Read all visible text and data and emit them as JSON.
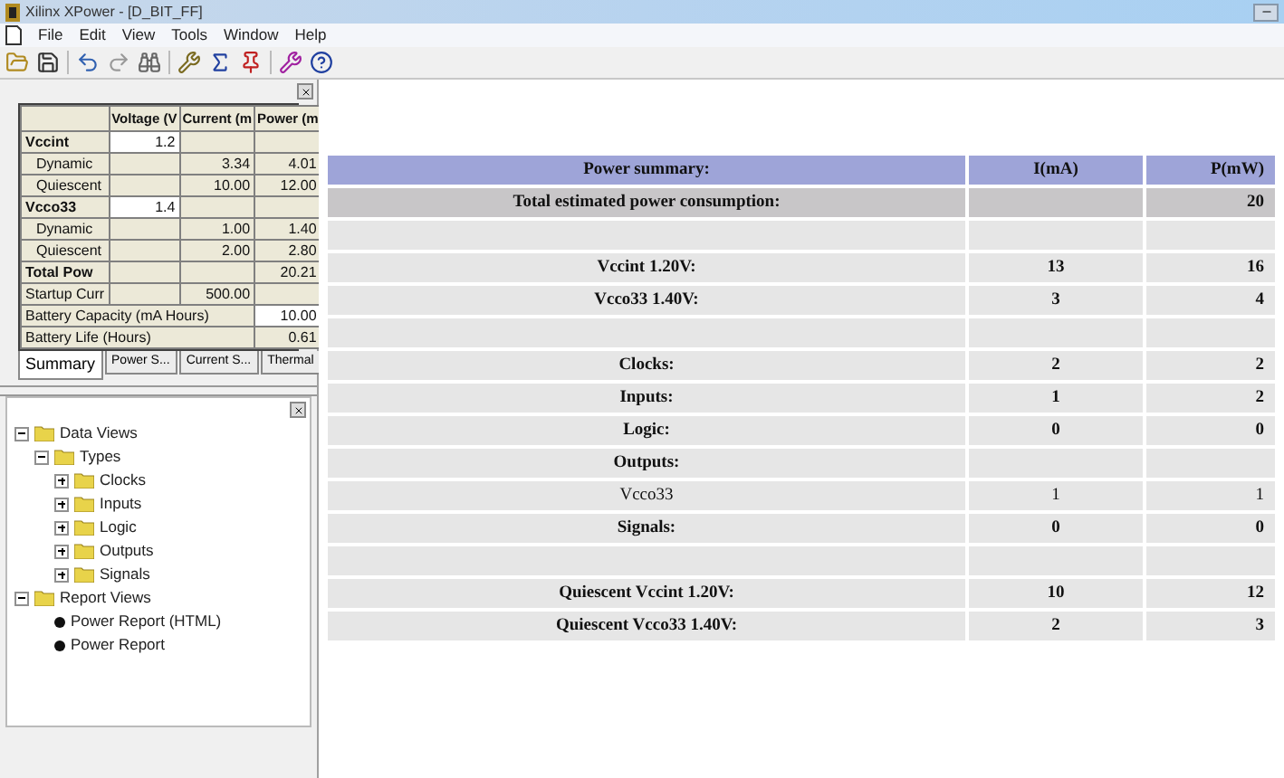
{
  "window": {
    "title": "Xilinx XPower - [D_BIT_FF]"
  },
  "menu": [
    "File",
    "Edit",
    "View",
    "Tools",
    "Window",
    "Help"
  ],
  "grid": {
    "columns": [
      "Voltage (V",
      "Current (m",
      "Power (m"
    ],
    "rows": [
      {
        "kind": "group",
        "label": "Vccint",
        "voltage": "1.2"
      },
      {
        "kind": "item",
        "label": "Dynamic",
        "current": "3.34",
        "power": "4.01"
      },
      {
        "kind": "item",
        "label": "Quiescent",
        "current": "10.00",
        "power": "12.00"
      },
      {
        "kind": "group",
        "label": "Vcco33",
        "voltage": "1.4"
      },
      {
        "kind": "item",
        "label": "Dynamic",
        "current": "1.00",
        "power": "1.40"
      },
      {
        "kind": "item",
        "label": "Quiescent",
        "current": "2.00",
        "power": "2.80"
      },
      {
        "kind": "total",
        "label": "Total Pow",
        "power": "20.21"
      },
      {
        "kind": "plain",
        "label": "Startup Curr",
        "current": "500.00"
      },
      {
        "kind": "wide",
        "label": "Battery Capacity (mA Hours)",
        "power": "10.00",
        "editable": true
      },
      {
        "kind": "wide",
        "label": "Battery Life (Hours)",
        "power": "0.61",
        "editable": false
      }
    ]
  },
  "tabs": [
    {
      "label": "Summary",
      "selected": true
    },
    {
      "label": "Power S...",
      "selected": false
    },
    {
      "label": "Current S...",
      "selected": false
    },
    {
      "label": "Thermal",
      "selected": false
    }
  ],
  "tree": [
    {
      "label": "Data Views",
      "kind": "folder",
      "expanded": true,
      "children": [
        {
          "label": "Types",
          "kind": "folder",
          "expanded": true,
          "children": [
            {
              "label": "Clocks",
              "kind": "folder",
              "expanded": false
            },
            {
              "label": "Inputs",
              "kind": "folder",
              "expanded": false
            },
            {
              "label": "Logic",
              "kind": "folder",
              "expanded": false
            },
            {
              "label": "Outputs",
              "kind": "folder",
              "expanded": false
            },
            {
              "label": "Signals",
              "kind": "folder",
              "expanded": false
            }
          ]
        }
      ]
    },
    {
      "label": "Report Views",
      "kind": "folder",
      "expanded": true,
      "children": [
        {
          "label": "Power Report (HTML)",
          "kind": "report"
        },
        {
          "label": "Power Report",
          "kind": "report"
        }
      ]
    }
  ],
  "report": {
    "rows": [
      {
        "kind": "header",
        "label": "Power summary:",
        "current": "I(mA)",
        "power": "P(mW)"
      },
      {
        "kind": "total",
        "label": "Total estimated power consumption:",
        "power": "20"
      },
      {
        "kind": "blank"
      },
      {
        "kind": "data",
        "label": "Vccint 1.20V:",
        "current": "13",
        "power": "16"
      },
      {
        "kind": "data",
        "label": "Vcco33 1.40V:",
        "current": "3",
        "power": "4"
      },
      {
        "kind": "blank"
      },
      {
        "kind": "data",
        "label": "Clocks:",
        "current": "2",
        "power": "2"
      },
      {
        "kind": "data",
        "label": "Inputs:",
        "current": "1",
        "power": "2"
      },
      {
        "kind": "data",
        "label": "Logic:",
        "current": "0",
        "power": "0"
      },
      {
        "kind": "data",
        "label": "Outputs:"
      },
      {
        "kind": "data",
        "label": "Vcco33",
        "current": "1",
        "power": "1",
        "plain": true
      },
      {
        "kind": "data",
        "label": "Signals:",
        "current": "0",
        "power": "0"
      },
      {
        "kind": "blank"
      },
      {
        "kind": "data",
        "label": "Quiescent Vccint 1.20V:",
        "current": "10",
        "power": "12"
      },
      {
        "kind": "data",
        "label": "Quiescent Vcco33 1.40V:",
        "current": "2",
        "power": "3"
      }
    ]
  }
}
